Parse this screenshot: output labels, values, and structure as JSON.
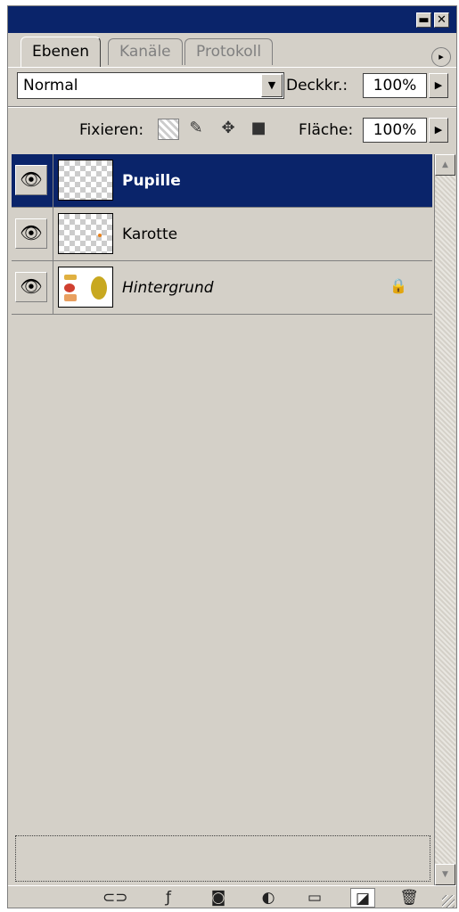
{
  "window": {
    "minimize_glyph": "▬",
    "close_glyph": "✕"
  },
  "tabs": [
    {
      "label": "Ebenen",
      "active": true
    },
    {
      "label": "Kanäle",
      "active": false
    },
    {
      "label": "Protokoll",
      "active": false
    }
  ],
  "panel_menu_glyph": "▸",
  "blend": {
    "mode": "Normal",
    "opacity_label": "Deckkr.:",
    "opacity_value": "100%"
  },
  "lock": {
    "label": "Fixieren:",
    "fill_label": "Fläche:",
    "fill_value": "100%"
  },
  "layers": [
    {
      "name": "Pupille",
      "visible": true,
      "selected": true,
      "locked": false,
      "italic": false
    },
    {
      "name": "Karotte",
      "visible": true,
      "selected": false,
      "locked": false,
      "italic": false
    },
    {
      "name": "Hintergrund",
      "visible": true,
      "selected": false,
      "locked": true,
      "italic": true
    }
  ],
  "glyphs": {
    "eye": "👁",
    "padlock": "🔒",
    "dropdown": "▼",
    "right": "▶",
    "up": "▲",
    "down": "▼"
  },
  "bottom_icons": [
    "link-icon",
    "layer-style-icon",
    "layer-mask-icon",
    "adjustment-layer-icon",
    "group-folder-icon",
    "new-layer-icon",
    "trash-icon"
  ],
  "colors": {
    "selection": "#0a246a",
    "panel": "#d4d0c8",
    "titlebar": "#0a246a"
  }
}
